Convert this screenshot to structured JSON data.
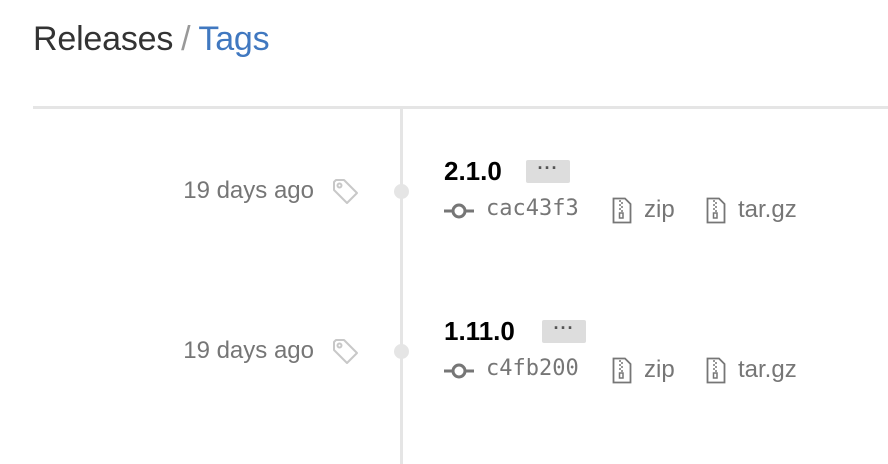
{
  "header": {
    "releases_label": "Releases",
    "separator": "/",
    "tags_label": "Tags"
  },
  "tags": [
    {
      "date": "19 days ago",
      "name": "2.1.0",
      "more_label": "···",
      "sha": "cac43f3",
      "zip_label": "zip",
      "tar_label": "tar.gz"
    },
    {
      "date": "19 days ago",
      "name": "1.11.0",
      "more_label": "···",
      "sha": "c4fb200",
      "zip_label": "zip",
      "tar_label": "tar.gz"
    }
  ],
  "colors": {
    "link": "#4078c0",
    "muted": "#767676",
    "rule": "#e5e5e5"
  },
  "icons": [
    "tag-icon",
    "commit-icon",
    "file-zip-icon"
  ]
}
